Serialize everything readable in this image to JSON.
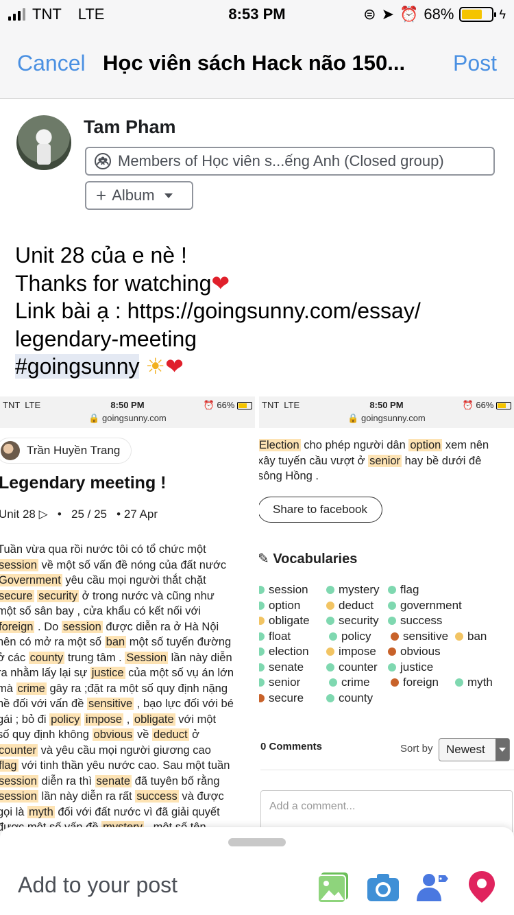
{
  "status_bar": {
    "carrier": "TNT",
    "network": "LTE",
    "time": "8:53 PM",
    "battery": "68%"
  },
  "nav": {
    "cancel_label": "Cancel",
    "title": "Học viên sách Hack não 150...",
    "post_label": "Post"
  },
  "composer": {
    "author": "Tam Pham",
    "audience": "Members of Học viên s...ếng Anh (Closed group)",
    "album_label": "Album",
    "text_lines": [
      "Unit 28 của e nè !",
      "Thanks for watching",
      "Link bài ạ : https://goingsunny.com/essay/",
      "legendary-meeting",
      "#goingsunny"
    ]
  },
  "attachment_left": {
    "status": {
      "carrier": "TNT",
      "network": "LTE",
      "time": "8:50 PM",
      "battery": "66%",
      "url": "goingsunny.com"
    },
    "author": "Trần Huyền Trang",
    "title": "Legendary meeting !",
    "unit": "Unit 28",
    "progress": "25 / 25",
    "date": "• 27 Apr",
    "body": [
      [
        [
          "Tuần vừa qua rồi nước tôi có tổ chức một",
          0
        ]
      ],
      [
        [
          "session",
          1
        ],
        [
          " về một số vấn đề nóng của đất nước",
          0
        ]
      ],
      [
        [
          "Government",
          1
        ],
        [
          " yêu cầu mọi người thắt chặt",
          0
        ]
      ],
      [
        [
          "secure",
          1
        ],
        [
          " ",
          0
        ],
        [
          "security",
          1
        ],
        [
          " ở trong nước và cũng như",
          0
        ]
      ],
      [
        [
          "một số sân bay , cửa khẩu có kết nối với",
          0
        ]
      ],
      [
        [
          "foreign",
          1
        ],
        [
          " . Do ",
          0
        ],
        [
          "session",
          1
        ],
        [
          " được diễn ra ở Hà Nội",
          0
        ]
      ],
      [
        [
          "nên có mở ra một số ",
          0
        ],
        [
          "ban",
          1
        ],
        [
          " một số tuyến đường",
          0
        ]
      ],
      [
        [
          "ở các ",
          0
        ],
        [
          "county",
          1
        ],
        [
          " trung tâm . ",
          0
        ],
        [
          "Session",
          1
        ],
        [
          " lần này diễn",
          0
        ]
      ],
      [
        [
          "ra nhằm lấy lại sự ",
          0
        ],
        [
          "justice",
          1
        ],
        [
          " của một số vụ án lớn",
          0
        ]
      ],
      [
        [
          "mà ",
          0
        ],
        [
          "crime",
          1
        ],
        [
          " gây ra ;đặt ra một số quy định nặng",
          0
        ]
      ],
      [
        [
          "nề đối với vấn đề ",
          0
        ],
        [
          "sensitive",
          1
        ],
        [
          " , bạo lực đối với bé",
          0
        ]
      ],
      [
        [
          "gái ; bỏ đi ",
          0
        ],
        [
          "policy",
          1
        ],
        [
          " ",
          0
        ],
        [
          "impose",
          1
        ],
        [
          " , ",
          0
        ],
        [
          "obligate",
          1
        ],
        [
          " với một",
          0
        ]
      ],
      [
        [
          "số quy định không ",
          0
        ],
        [
          "obvious",
          1
        ],
        [
          " về ",
          0
        ],
        [
          "deduct",
          1
        ],
        [
          " ở",
          0
        ]
      ],
      [
        [
          "counter",
          1
        ],
        [
          " và yêu cầu mọi người giương cao",
          0
        ]
      ],
      [
        [
          "flag",
          1
        ],
        [
          " với tinh thần yêu nước cao. Sau một tuần",
          0
        ]
      ],
      [
        [
          "session",
          1
        ],
        [
          " diễn ra thì ",
          0
        ],
        [
          "senate",
          1
        ],
        [
          " đã tuyên bố rằng",
          0
        ]
      ],
      [
        [
          "session",
          1
        ],
        [
          " lần này diễn ra rất ",
          0
        ],
        [
          "success",
          1
        ],
        [
          " và được",
          0
        ]
      ],
      [
        [
          "gọi là ",
          0
        ],
        [
          "myth",
          1
        ],
        [
          " đối với đất nước vì đã giải quyết",
          0
        ]
      ],
      [
        [
          "được một số vấn đề ",
          0
        ],
        [
          "mystery",
          1
        ],
        [
          " . một số tên",
          0
        ]
      ]
    ]
  },
  "attachment_right": {
    "status": {
      "carrier": "TNT",
      "network": "LTE",
      "time": "8:50 PM",
      "battery": "66%",
      "url": "goingsunny.com"
    },
    "body": [
      [
        [
          "Election",
          1
        ],
        [
          " cho phép người dân ",
          0
        ],
        [
          "option",
          1
        ],
        [
          " xem nên",
          0
        ]
      ],
      [
        [
          "xây tuyến cầu vượt ở ",
          0
        ],
        [
          "senior",
          1
        ],
        [
          " hay bề dưới đê",
          0
        ]
      ],
      [
        [
          "sông Hồng .",
          0
        ]
      ]
    ],
    "share_label": "Share to facebook",
    "vocab_title": "Vocabularies",
    "vocab_rows": [
      [
        [
          "session",
          "#7fd8b0"
        ],
        [
          "mystery",
          "#7fd8b0"
        ],
        [
          "flag",
          "#7fd8b0"
        ]
      ],
      [
        [
          "option",
          "#7fd8b0"
        ],
        [
          "deduct",
          "#f2c463"
        ],
        [
          "government",
          "#7fd8b0"
        ]
      ],
      [
        [
          "obligate",
          "#f2c463"
        ],
        [
          "security",
          "#7fd8b0"
        ],
        [
          "success",
          "#7fd8b0"
        ]
      ],
      [
        [
          "float",
          "#7fd8b0"
        ],
        [
          "policy",
          "#7fd8b0"
        ],
        [
          "sensitive",
          "#c8622a"
        ],
        [
          "ban",
          "#f2c463"
        ]
      ],
      [
        [
          "election",
          "#7fd8b0"
        ],
        [
          "impose",
          "#f2c463"
        ],
        [
          "obvious",
          "#c8622a"
        ]
      ],
      [
        [
          "senate",
          "#7fd8b0"
        ],
        [
          "counter",
          "#7fd8b0"
        ],
        [
          "justice",
          "#7fd8b0"
        ]
      ],
      [
        [
          "senior",
          "#7fd8b0"
        ],
        [
          "crime",
          "#7fd8b0"
        ],
        [
          "foreign",
          "#c8622a"
        ],
        [
          "myth",
          "#7fd8b0"
        ]
      ],
      [
        [
          "secure",
          "#c8622a"
        ],
        [
          "county",
          "#7fd8b0"
        ]
      ]
    ],
    "comments_label": "0 Comments",
    "sort_label": "Sort by",
    "sort_value": "Newest",
    "comment_placeholder": "Add a comment..."
  },
  "bottom_sheet": {
    "label": "Add to your post",
    "icons": [
      "photo-icon",
      "camera-icon",
      "tag-people-icon",
      "location-icon"
    ]
  },
  "colors": {
    "accent": "#4a90e2",
    "highlight": "#fde3b4",
    "photo_icon": "#6bbf59",
    "camera_icon": "#3f8fd6",
    "tag_icon": "#4a78e0",
    "location_icon": "#e0245e"
  }
}
